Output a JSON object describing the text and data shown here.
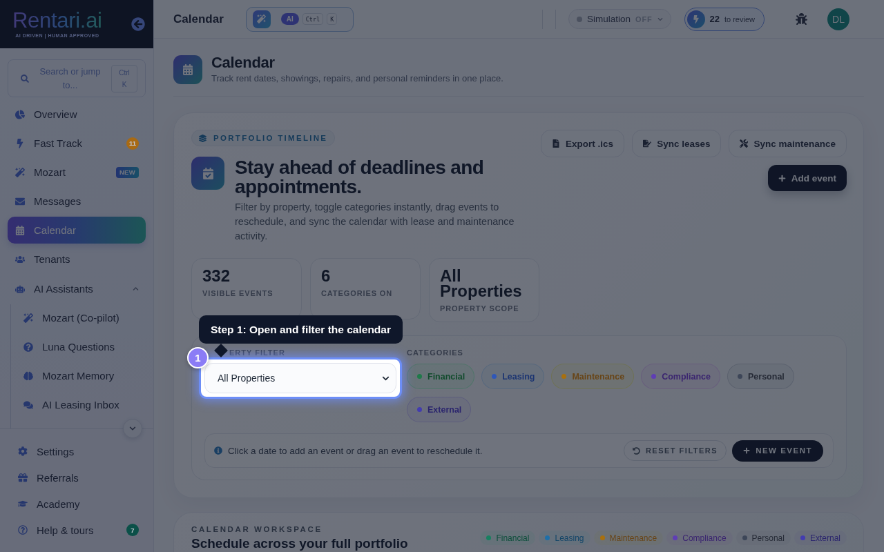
{
  "sidebar": {
    "logo": {
      "name": "Rentari.ai",
      "tagline": "AI DRIVEN | HUMAN APPROVED"
    },
    "search": {
      "placeholder": "Search or jump to...",
      "shortcut": "Ctrl K"
    },
    "items": [
      {
        "label": "Overview",
        "selected": false
      },
      {
        "label": "Fast Track",
        "selected": false,
        "badge": {
          "kind": "count",
          "text": "11",
          "color": "#a86a14"
        }
      },
      {
        "label": "Mozart",
        "selected": false,
        "badge": {
          "kind": "tag",
          "text": "NEW"
        }
      },
      {
        "label": "Messages",
        "selected": false
      },
      {
        "label": "Calendar",
        "selected": true
      },
      {
        "label": "Tenants",
        "selected": false
      },
      {
        "label": "AI Assistants",
        "selected": false,
        "expanded": true,
        "children": [
          {
            "label": "Mozart (Co-pilot)",
            "selected": false
          },
          {
            "label": "Luna Questions",
            "selected": false
          },
          {
            "label": "Mozart Memory",
            "selected": false
          },
          {
            "label": "AI Leasing Inbox",
            "selected": false
          }
        ]
      }
    ],
    "footer_items": [
      {
        "label": "Settings",
        "selected": false
      },
      {
        "label": "Referrals",
        "selected": false
      },
      {
        "label": "Academy",
        "selected": false
      },
      {
        "label": "Help & tours",
        "selected": false,
        "badge": {
          "kind": "count",
          "text": "7",
          "color": "#0b5048"
        }
      }
    ]
  },
  "topbar": {
    "title": "Calendar",
    "command": {
      "ai_label": "AI",
      "keys": [
        "Ctrl",
        "K"
      ]
    },
    "simulation": {
      "label": "Simulation",
      "state": "OFF",
      "on": false
    },
    "review": {
      "count": "22",
      "label": "to review"
    },
    "avatar": {
      "initials": "DL"
    }
  },
  "page_header": {
    "title": "Calendar",
    "subtitle": "Track rent dates, showings, repairs, and personal reminders in one place."
  },
  "timeline_card": {
    "tag": "PORTFOLIO TIMELINE",
    "actions": [
      {
        "label": "Export .ics"
      },
      {
        "label": "Sync leases"
      },
      {
        "label": "Sync maintenance"
      }
    ],
    "title": "Stay ahead of deadlines and appointments.",
    "description": "Filter by property, toggle categories instantly, drag events to reschedule, and sync the calendar with lease and maintenance activity.",
    "add_button": "Add event",
    "stats": [
      {
        "value": "332",
        "label": "VISIBLE EVENTS"
      },
      {
        "value": "6",
        "label": "CATEGORIES ON"
      },
      {
        "value": "All Properties",
        "label": "PROPERTY SCOPE"
      }
    ],
    "filters": {
      "property_label": "ERTY FILTER",
      "property_value": "All Properties",
      "categories_label": "CATEGORIES",
      "categories": [
        {
          "label": "Financial",
          "on": true,
          "color": "#1f7a4a"
        },
        {
          "label": "Leasing",
          "on": true,
          "color": "#2f57b8"
        },
        {
          "label": "Maintenance",
          "on": true,
          "color": "#a8700f"
        },
        {
          "label": "Compliance",
          "on": true,
          "color": "#5f3db5"
        },
        {
          "label": "Personal",
          "on": true,
          "color": "#3d4658"
        },
        {
          "label": "External",
          "on": true,
          "color": "#433cb0"
        }
      ],
      "hint": "Click a date to add an event or drag an event to reschedule it.",
      "reset_button": "RESET FILTERS",
      "new_event_button": "NEW EVENT"
    }
  },
  "tour": {
    "step": "1",
    "text": "Step 1: Open and filter the calendar"
  },
  "workspace": {
    "tag": "CALENDAR WORKSPACE",
    "title": "Schedule across your full portfolio",
    "legend": [
      {
        "label": "Financial",
        "color": "#178060"
      },
      {
        "label": "Leasing",
        "color": "#1f6fa8"
      },
      {
        "label": "Maintenance",
        "color": "#a8700f"
      },
      {
        "label": "Compliance",
        "color": "#5f3db5"
      },
      {
        "label": "Personal",
        "color": "#3d4658"
      },
      {
        "label": "External",
        "color": "#433cb0"
      }
    ]
  }
}
